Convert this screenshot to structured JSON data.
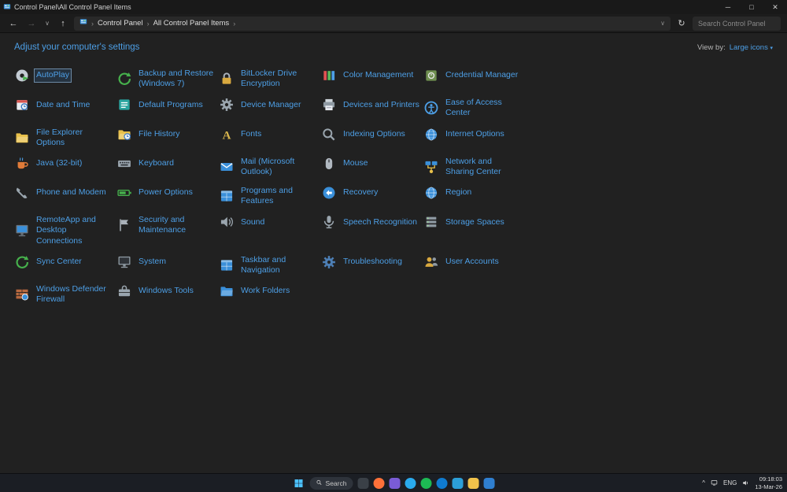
{
  "window": {
    "title": "Control Panel\\All Control Panel Items",
    "minimize_glyph": "─",
    "maximize_glyph": "□",
    "close_glyph": "✕"
  },
  "toolbar": {
    "back_glyph": "←",
    "forward_glyph": "→",
    "up_glyph": "↑",
    "history_caret": "∨",
    "breadcrumb_root": "Control Panel",
    "breadcrumb_current": "All Control Panel Items",
    "breadcrumb_sep": "›",
    "address_caret": "∨",
    "refresh_glyph": "↻",
    "search_placeholder": "Search Control Panel"
  },
  "header": {
    "title": "Adjust your computer's settings",
    "view_by_label": "View by:",
    "view_by_value": "Large icons",
    "view_by_caret": "▾"
  },
  "colors": {
    "link_blue": "#4d9fe6",
    "background": "#212121",
    "titlebar": "#191919",
    "taskbar": "#1b1e24"
  },
  "items": [
    {
      "label": "AutoPlay",
      "icon": "disc",
      "c1": "#c3cbd3",
      "c2": "#46b14c",
      "selected": true
    },
    {
      "label": "Backup and Restore (Windows 7)",
      "icon": "sync",
      "c1": "#46b14c",
      "c2": "#46b14c"
    },
    {
      "label": "BitLocker Drive Encryption",
      "icon": "lock",
      "c1": "#d9a93f",
      "c2": "#aab2ba"
    },
    {
      "label": "Color Management",
      "icon": "bars",
      "c1": "#e05252",
      "c2": "#4d9fe6"
    },
    {
      "label": "Credential Manager",
      "icon": "safe",
      "c1": "#6f8f4f",
      "c2": "#e8e8e8"
    },
    {
      "label": "Date and Time",
      "icon": "calendar",
      "c1": "#3a78c2",
      "c2": "#d95550"
    },
    {
      "label": "Default Programs",
      "icon": "list",
      "c1": "#2aa5a0",
      "c2": "#ffffff"
    },
    {
      "label": "Device Manager",
      "icon": "gear",
      "c1": "#9aa5ae",
      "c2": "#212121"
    },
    {
      "label": "Devices and Printers",
      "icon": "printer",
      "c1": "#8f9aa3",
      "c2": "#e9edf2"
    },
    {
      "label": "Ease of Access Center",
      "icon": "access",
      "c1": "#4d9fe6",
      "c2": "#4d9fe6"
    },
    {
      "label": "File Explorer Options",
      "icon": "folder",
      "c1": "#e8c04a",
      "c2": "#ffffff"
    },
    {
      "label": "File History",
      "icon": "folderclock",
      "c1": "#e8c04a",
      "c2": "#3a78c2"
    },
    {
      "label": "Fonts",
      "icon": "fontA",
      "c1": "#d8b54d",
      "c2": "#ffffff"
    },
    {
      "label": "Indexing Options",
      "icon": "magnifier",
      "c1": "#9aa5ae",
      "c2": "#9aa5ae"
    },
    {
      "label": "Internet Options",
      "icon": "globe",
      "c1": "#3a8fd9",
      "c2": "#ffffff"
    },
    {
      "label": "Java (32-bit)",
      "icon": "cup",
      "c1": "#e07b39",
      "c2": "#4d9fe6"
    },
    {
      "label": "Keyboard",
      "icon": "keyboard",
      "c1": "#9aa5ae",
      "c2": "#23262a"
    },
    {
      "label": "Mail (Microsoft Outlook)",
      "icon": "envelope",
      "c1": "#3a8fd9",
      "c2": "#ffffff"
    },
    {
      "label": "Mouse",
      "icon": "mouse",
      "c1": "#b0b8c0",
      "c2": "#23262a"
    },
    {
      "label": "Network and Sharing Center",
      "icon": "network",
      "c1": "#3a8fd9",
      "c2": "#e8c04a"
    },
    {
      "label": "Phone and Modem",
      "icon": "phone",
      "c1": "#9aa5ae",
      "c2": "#9aa5ae"
    },
    {
      "label": "Power Options",
      "icon": "battery",
      "c1": "#46b14c",
      "c2": "#46b14c"
    },
    {
      "label": "Programs and Features",
      "icon": "window",
      "c1": "#3a8fd9",
      "c2": "#ffffff"
    },
    {
      "label": "Recovery",
      "icon": "recovery",
      "c1": "#3a8fd9",
      "c2": "#ffffff"
    },
    {
      "label": "Region",
      "icon": "globe",
      "c1": "#3a8fd9",
      "c2": "#ffffff"
    },
    {
      "label": "RemoteApp and Desktop Connections",
      "icon": "monitor",
      "c1": "#3a8fd9",
      "c2": "#6b7680"
    },
    {
      "label": "Security and Maintenance",
      "icon": "flag",
      "c1": "#aab2ba",
      "c2": "#aab2ba"
    },
    {
      "label": "Sound",
      "icon": "speaker",
      "c1": "#9aa5ae",
      "c2": "#9aa5ae"
    },
    {
      "label": "Speech Recognition",
      "icon": "mic",
      "c1": "#9aa5ae",
      "c2": "#9aa5ae"
    },
    {
      "label": "Storage Spaces",
      "icon": "stack",
      "c1": "#8f9aa3",
      "c2": "#9fe08f"
    },
    {
      "label": "Sync Center",
      "icon": "sync",
      "c1": "#46b14c",
      "c2": "#46b14c"
    },
    {
      "label": "System",
      "icon": "monitor",
      "c1": "#2f3338",
      "c2": "#8f9aa3"
    },
    {
      "label": "Taskbar and Navigation",
      "icon": "window",
      "c1": "#3a8fd9",
      "c2": "#ffffff"
    },
    {
      "label": "Troubleshooting",
      "icon": "gear",
      "c1": "#4d7fb5",
      "c2": "#212121"
    },
    {
      "label": "User Accounts",
      "icon": "people",
      "c1": "#d9a93f",
      "c2": "#8f9aa3"
    },
    {
      "label": "Windows Defender Firewall",
      "icon": "wall",
      "c1": "#b8693f",
      "c2": "#3a8fd9"
    },
    {
      "label": "Windows Tools",
      "icon": "toolbox",
      "c1": "#9aa5ae",
      "c2": "#9aa5ae"
    },
    {
      "label": "Work Folders",
      "icon": "folder",
      "c1": "#3a8fd9",
      "c2": "#ffffff"
    }
  ],
  "taskbar": {
    "search_label": "Search",
    "apps": [
      {
        "name": "taskbar-app-1",
        "color": "#3a4047",
        "shape": "square"
      },
      {
        "name": "taskbar-app-firefox",
        "color": "#ff7139",
        "shape": "round"
      },
      {
        "name": "taskbar-app-2",
        "color": "#7a5cd6",
        "shape": "square"
      },
      {
        "name": "taskbar-app-3",
        "color": "#2aabee",
        "shape": "round"
      },
      {
        "name": "taskbar-app-4",
        "color": "#1db954",
        "shape": "round"
      },
      {
        "name": "taskbar-app-edge",
        "color": "#0f7bd0",
        "shape": "round"
      },
      {
        "name": "taskbar-app-5",
        "color": "#2c9fd8",
        "shape": "square"
      },
      {
        "name": "taskbar-app-explorer",
        "color": "#f0c24b",
        "shape": "square"
      },
      {
        "name": "taskbar-app-6",
        "color": "#2f7fd0",
        "shape": "square"
      }
    ],
    "tray": {
      "chevron": "^",
      "language": "ENG",
      "time": "09:18:03",
      "date": "13-Mar-26"
    }
  }
}
